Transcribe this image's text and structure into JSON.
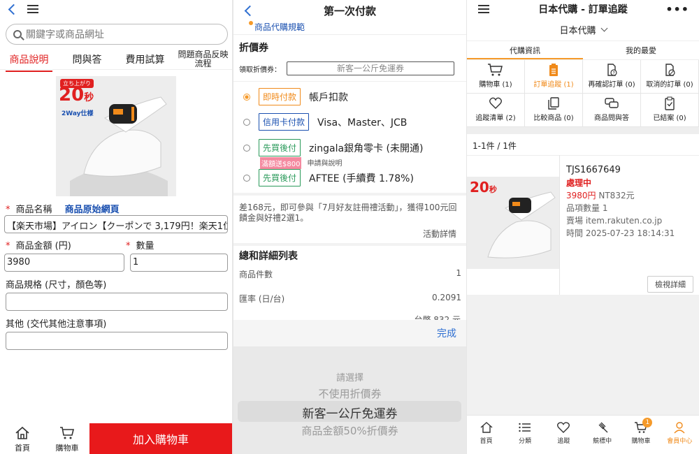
{
  "colors": {
    "accent_red": "#e8191b",
    "accent_orange": "#f59a2a",
    "link_blue": "#2f6fd1"
  },
  "left": {
    "search_placeholder": "關鍵字或商品網址",
    "tabs": [
      "商品說明",
      "問與答",
      "費用試算",
      "問題商品反映流程"
    ],
    "image": {
      "badge_top": "立ち上がり",
      "badge_num": "20",
      "badge_unit": "秒",
      "badge_sub": "2Way仕様"
    },
    "name_label": "商品名稱",
    "orig_link": "商品原始網頁",
    "name_value": "【楽天市場】アイロン【クーポンで 3,179円！楽天1位】ス...",
    "price_label": "商品金額 (円)",
    "qty_label": "數量",
    "price_value": "3980",
    "qty_value": "1",
    "spec_label": "商品規格 (尺寸，顏色等)",
    "other_label": "其他 (交代其他注意事項)",
    "nav_home": "首頁",
    "nav_cart": "購物車",
    "add_cart": "加入購物車"
  },
  "middle": {
    "title": "第一次付款",
    "rules_link": "商品代購規範",
    "coupon_section": "折價券",
    "coupon_label": "領取折價券：",
    "coupon_value": "新客一公斤免運券",
    "payments": [
      {
        "badge": "即時付款",
        "text": "帳戶扣款"
      },
      {
        "badge": "信用卡付款",
        "text": "Visa、Master、JCB"
      },
      {
        "badge": "先買後付",
        "text": "zingala銀角零卡 (未開通)",
        "promo": "滿額送$800",
        "note": "申請與說明"
      },
      {
        "badge": "先買後付",
        "text": "AFTEE (手續費 1.78%)"
      }
    ],
    "promo_text": "差168元，即可參與「7月好友註冊禮活動」，獲得100元回饋金與好禮2選1。",
    "promo_link": "活動詳情",
    "summary_title": "總和詳細列表",
    "rows": [
      {
        "k": "商品件數",
        "v": "1"
      },
      {
        "k": "匯率 (日/台)",
        "v": "0.2091"
      }
    ],
    "partial_row": "台幣 832 元",
    "done": "完成",
    "picker": [
      "請選擇",
      "不使用折價券",
      "新客一公斤免運券",
      "商品金額50%折價券"
    ]
  },
  "right": {
    "title": "日本代購 - 訂單追蹤",
    "dots": "•••",
    "sub": "日本代購",
    "tabs": [
      "代購資訊",
      "我的最愛"
    ],
    "grid": [
      {
        "label": "購物車 (1)",
        "icon": "cart-icon"
      },
      {
        "label": "訂單追蹤 (1)",
        "icon": "clipboard-icon"
      },
      {
        "label": "再確認訂單 (0)",
        "icon": "doc-question-icon"
      },
      {
        "label": "取消的訂單 (0)",
        "icon": "doc-cancel-icon"
      },
      {
        "label": "追蹤清單 (2)",
        "icon": "heart-icon"
      },
      {
        "label": "比較商品 (0)",
        "icon": "compare-icon"
      },
      {
        "label": "商品問與答",
        "icon": "chat-icon"
      },
      {
        "label": "已結案 (0)",
        "icon": "clipboard-check-icon"
      }
    ],
    "count": "1-1件 / 1件",
    "order": {
      "id": "TJS1667649",
      "status": "處理中",
      "price_jpy": "3980円",
      "price_twd": "NT832元",
      "qty": "品項數量 1",
      "store": "賣場 item.rakuten.co.jp",
      "time": "時間 2025-07-23 18:14:31",
      "detail": "檢視詳細"
    },
    "nav": [
      "首頁",
      "分類",
      "追蹤",
      "競標中",
      "購物車",
      "會員中心"
    ],
    "cart_badge": "1"
  }
}
